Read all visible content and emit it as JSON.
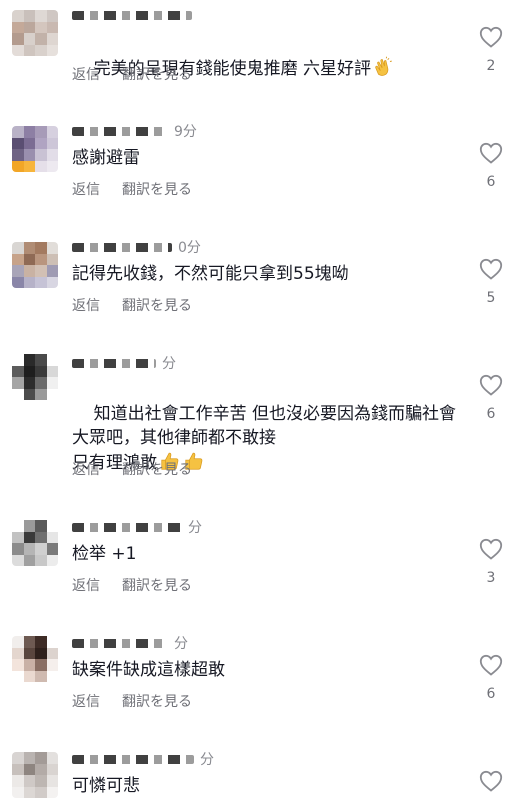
{
  "labels": {
    "reply": "返信",
    "translate": "翻訳を見る",
    "time_suffix": "分"
  },
  "icons": {
    "like": "heart-outline-icon",
    "clap": "clapping-hands-emoji",
    "thumbs": "thumbs-up-emoji"
  },
  "colors": {
    "text": "#161823",
    "secondary": "#6f7077",
    "time": "#8a8b91"
  },
  "comments": [
    {
      "text": "完美的呈現有錢能使鬼推磨 六星好評",
      "time": "",
      "likes": "2"
    },
    {
      "text": "感謝避雷",
      "time": "9分",
      "likes": "6"
    },
    {
      "text": "記得先收錢，不然可能只拿到55塊呦",
      "time": "0分",
      "likes": "5"
    },
    {
      "text": "知道出社會工作辛苦 但也沒必要因為錢而騙社會大眾吧，其他律師都不敢接\n只有理鴻敢",
      "time": "分",
      "likes": "6"
    },
    {
      "text": "检举 +1",
      "time": "分",
      "likes": "3"
    },
    {
      "text": "缺案件缺成這樣超敢",
      "time": "分",
      "likes": "6"
    },
    {
      "text": "可憐可悲",
      "time": "分",
      "likes": ""
    }
  ]
}
